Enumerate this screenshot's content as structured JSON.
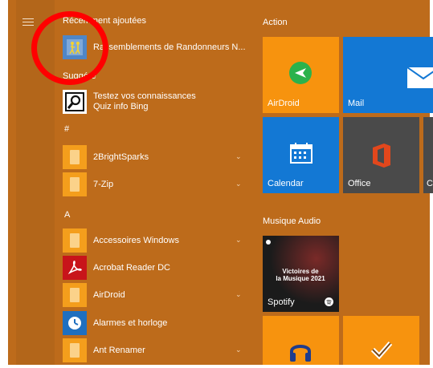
{
  "menu": {
    "recently_added_heading": "Récemment ajoutées",
    "recent_app_label": "Rassemblements de Randonneurs N...",
    "suggested_heading": "Suggéré",
    "suggested_title": "Testez vos connaissances",
    "suggested_subtitle": "Quiz info Bing",
    "hash_heading": "#",
    "a_heading": "A",
    "apps": [
      {
        "label": "2BrightSparks",
        "icon": "folder-icon",
        "expandable": true
      },
      {
        "label": "7-Zip",
        "icon": "folder-icon",
        "expandable": true
      },
      {
        "label": "Accessoires Windows",
        "icon": "folder-icon",
        "expandable": true
      },
      {
        "label": "Acrobat Reader DC",
        "icon": "acrobat-icon",
        "expandable": false
      },
      {
        "label": "AirDroid",
        "icon": "folder-icon",
        "expandable": true
      },
      {
        "label": "Alarmes et horloge",
        "icon": "clock-icon",
        "expandable": false
      },
      {
        "label": "Ant Renamer",
        "icon": "folder-icon",
        "expandable": true
      }
    ]
  },
  "tiles": {
    "action_heading": "Action",
    "airdroid": "AirDroid",
    "mail": "Mail",
    "calendar": "Calendar",
    "office": "Office",
    "partial_c": "C",
    "music_heading": "Musique Audio",
    "spotify_label": "Spotify",
    "victoires_line1": "Victoires de",
    "victoires_line2": "la Musique 2021"
  },
  "colors": {
    "start_bg": "#bd6b1b",
    "tile_orange": "#f7930e",
    "tile_blue": "#1378d4",
    "tile_gray": "#4a4a4a",
    "highlight_circle": "#ff0000"
  }
}
